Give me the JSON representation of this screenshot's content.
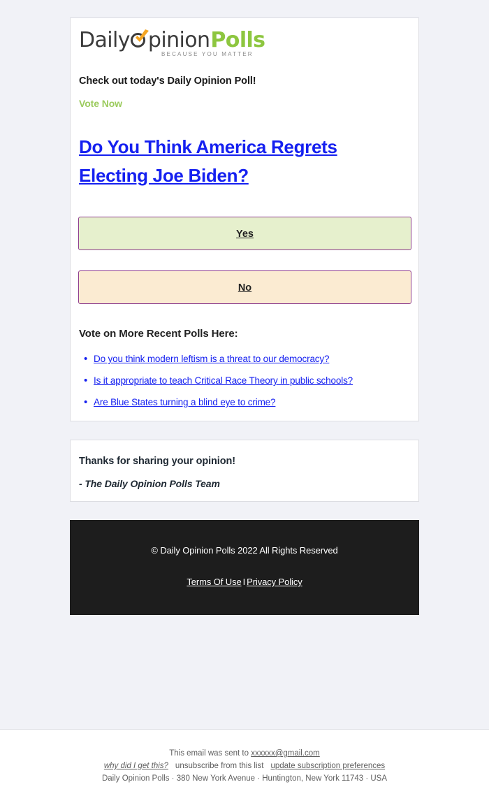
{
  "brand": {
    "logo": {
      "part1": "Daily",
      "part2": "pinion",
      "part3": "Polls",
      "tagline": "BECAUSE YOU MATTER",
      "dark_color": "#3b3b3b",
      "green_color": "#8dc63f",
      "check_color": "#f5a623"
    }
  },
  "main": {
    "subheading": "Check out today's Daily Opinion Poll!",
    "vote_now": "Vote Now",
    "question": "Do You Think America Regrets Electing Joe Biden?",
    "buttons": [
      {
        "label": "Yes",
        "bg": "#e6f0cd",
        "border": "#8e3d8e"
      },
      {
        "label": "No",
        "bg": "#fbebd2",
        "border": "#8e3d8e"
      }
    ],
    "more_polls_title": "Vote on More Recent Polls Here:",
    "more_polls": [
      "Do you think modern leftism is a threat to our democracy?",
      "Is it appropriate to teach Critical Race Theory in public schools?",
      "Are Blue States turning a blind eye to crime?"
    ]
  },
  "thanks": {
    "title": "Thanks for sharing your opinion!",
    "signature": "- The Daily Opinion Polls Team"
  },
  "dark_footer": {
    "copyright": "© Daily Opinion Polls 2022 All Rights Reserved",
    "terms_label": "Terms Of Use",
    "separator": "I",
    "privacy_label": "Privacy Policy",
    "bg": "#1d1d1d"
  },
  "bottom_footer": {
    "sent_to_prefix": "This email was sent to ",
    "email": "xxxxxx@gmail.com",
    "why_link": "why did I get this?",
    "unsubscribe": "unsubscribe from this list",
    "update_prefs": "update subscription preferences",
    "address": "Daily Opinion Polls · 380 New York Avenue · Huntington, New York 11743 · USA"
  },
  "colors": {
    "page_bg": "#f1f2f7",
    "link_blue": "#1520f0",
    "accent_green": "#9ccb5e"
  }
}
